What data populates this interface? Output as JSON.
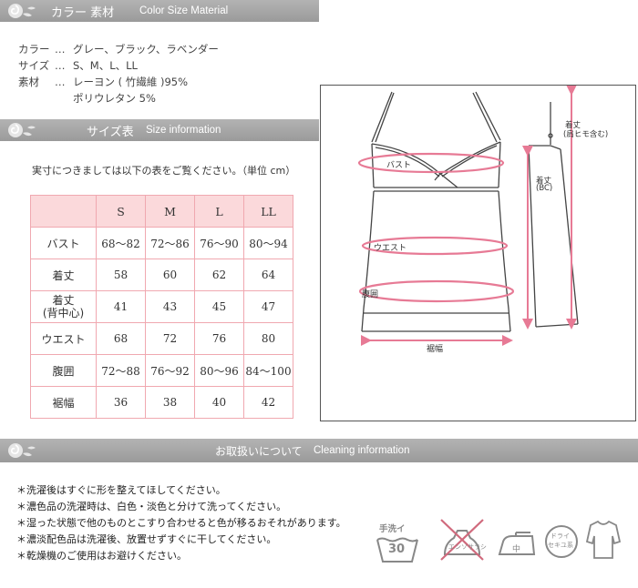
{
  "color_section": {
    "title_jp": "カラー 素材",
    "title_en": "Color Size Material"
  },
  "info": {
    "color_label": "カラー",
    "color_value": "グレー、ブラック、ラベンダー",
    "size_label": "サイズ",
    "size_value": "S、M、L、LL",
    "material_label": "素材",
    "material_value_1": "レーヨン ( 竹繊維 )95%",
    "material_value_2": "ポリウレタン 5%",
    "dots": "…"
  },
  "size_section": {
    "title_jp": "サイズ表",
    "title_en": "Size information",
    "note": "実寸につきましては以下の表をご覧ください。（単位 cm）"
  },
  "size_table": {
    "headers": [
      "",
      "S",
      "M",
      "L",
      "LL"
    ],
    "rows": [
      {
        "label": "バスト",
        "values": [
          "68～82",
          "72～86",
          "76～90",
          "80～94"
        ]
      },
      {
        "label": "着丈",
        "values": [
          "58",
          "60",
          "62",
          "64"
        ]
      },
      {
        "label": "着丈\n(背中心)",
        "label_1": "着丈",
        "label_2": "(背中心)",
        "values": [
          "41",
          "43",
          "45",
          "47"
        ]
      },
      {
        "label": "ウエスト",
        "values": [
          "68",
          "72",
          "76",
          "80"
        ]
      },
      {
        "label": "腹囲",
        "values": [
          "72～88",
          "76～92",
          "80～96",
          "84～100"
        ]
      },
      {
        "label": "裾幅",
        "values": [
          "36",
          "38",
          "40",
          "42"
        ]
      }
    ]
  },
  "diagram": {
    "bust": "バスト",
    "waist": "ウエスト",
    "belly": "腹囲",
    "hem": "裾幅",
    "length_strap_1": "着丈",
    "length_strap_2": "(肩ヒモ含む)",
    "length_bc_1": "着丈",
    "length_bc_2": "(BC)",
    "accent_color": "#e77a95"
  },
  "care_section": {
    "title_jp": "お取扱いについて",
    "title_en": "Cleaning information",
    "items": [
      "＊洗濯後はすぐに形を整えてほしてください。",
      "＊濃色品の洗濯時は、白色・淡色と分けて洗ってください。",
      "＊湿った状態で他のものとこすり合わせると色が移るおそれがあります。",
      "＊濃淡配色品は洗濯後、放置せずすぐに干してください。",
      "＊乾燥機のご使用はお避けください。"
    ],
    "icons": {
      "wash_label": "手洗イ",
      "wash_temp": "30",
      "bleach_label": "エンソサラシ",
      "iron_label": "中",
      "dry_label_1": "ドライ",
      "dry_label_2": "セキユ系"
    }
  }
}
